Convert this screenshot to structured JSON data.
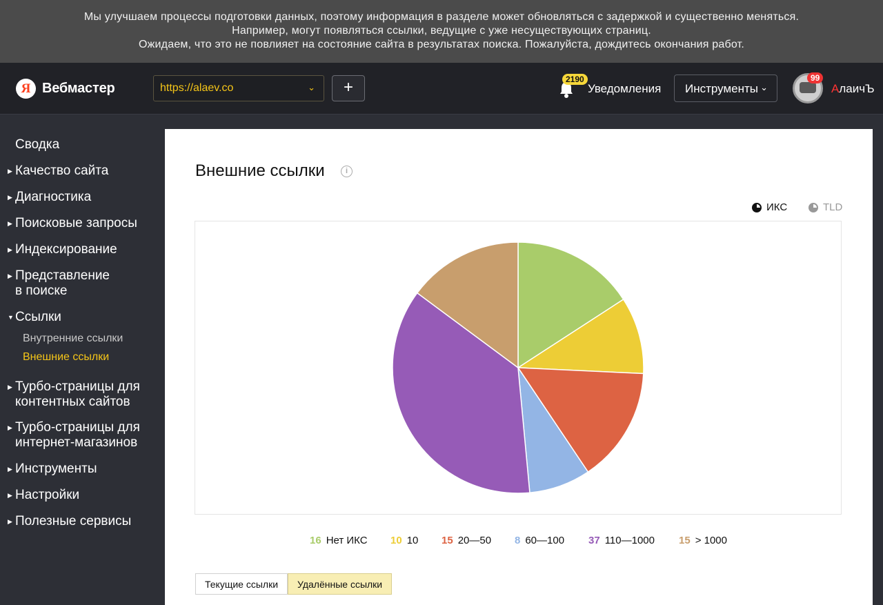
{
  "notice": {
    "lines": [
      "Мы улучшаем процессы подготовки данных, поэтому информация в разделе может обновляться с задержкой и существенно меняться.",
      "Например, могут появляться ссылки, ведущие с уже несуществующих страниц.",
      "Ожидаем, что это не повлияет на состояние сайта в результатах поиска. Пожалуйста, дождитесь окончания работ."
    ]
  },
  "header": {
    "logo_letter": "Я",
    "logo_text": "Вебмастер",
    "site_url": "https://alaev.co",
    "add_label": "+",
    "notifications_count": "2190",
    "notifications_label": "Уведомления",
    "tools_label": "Инструменты",
    "avatar_badge": "99",
    "user_first_letter": "А",
    "user_rest": "лаичЪ"
  },
  "sidebar": {
    "items": [
      {
        "label": "Сводка"
      },
      {
        "label": "Качество сайта"
      },
      {
        "label": "Диагностика"
      },
      {
        "label": "Поисковые запросы"
      },
      {
        "label": "Индексирование"
      },
      {
        "label": "Представление",
        "label2": "в поиске"
      },
      {
        "label": "Ссылки"
      },
      {
        "label": "Турбо-страницы для",
        "label2": "контентных сайтов"
      },
      {
        "label": "Турбо-страницы для",
        "label2": "интернет-магазинов"
      },
      {
        "label": "Инструменты"
      },
      {
        "label": "Настройки"
      },
      {
        "label": "Полезные сервисы"
      }
    ],
    "subitems": [
      {
        "label": "Внутренние ссылки"
      },
      {
        "label": "Внешние ссылки",
        "active": true
      }
    ]
  },
  "main": {
    "title": "Внешние ссылки",
    "info_symbol": "i",
    "toggles": {
      "iks": "ИКС",
      "tld": "TLD"
    },
    "tabs": [
      {
        "label": "Текущие ссылки",
        "active": false
      },
      {
        "label": "Удалённые ссылки",
        "active": true
      }
    ]
  },
  "chart_data": {
    "type": "pie",
    "categories": [
      "Нет ИКС",
      "10",
      "20—50",
      "60—100",
      "110—1000",
      "> 1000"
    ],
    "values": [
      16,
      10,
      15,
      8,
      37,
      15
    ],
    "colors": [
      "#a9cc6a",
      "#edcd36",
      "#dd6343",
      "#93b5e5",
      "#965bb7",
      "#c89e6d"
    ],
    "title": "",
    "legend_position": "bottom"
  }
}
